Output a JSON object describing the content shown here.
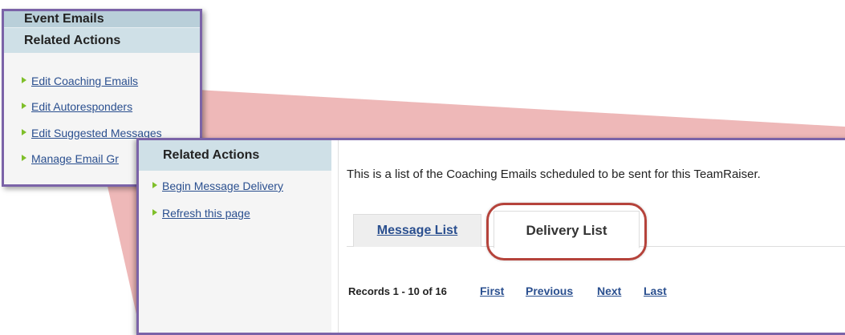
{
  "panel_top": {
    "title": "Event Emails",
    "heading": "Related Actions",
    "links": [
      "Edit Coaching Emails",
      "Edit Autoresponders",
      "Edit Suggested Messages",
      "Manage Email Gr"
    ]
  },
  "panel_main": {
    "sidebar": {
      "heading": "Related Actions",
      "links": [
        "Begin Message Delivery",
        "Refresh this page"
      ]
    },
    "description": "This is a list of the Coaching Emails scheduled to be sent for this TeamRaiser.",
    "tabs": {
      "message_list": "Message List",
      "delivery_list": "Delivery List"
    },
    "records": "Records 1 - 10 of 16",
    "pager": [
      "First",
      "Previous",
      "Next",
      "Last"
    ]
  },
  "colors": {
    "frame": "#7b63a8",
    "highlight_ring": "#b5433b",
    "connector": "#e8a0a0",
    "link": "#2a4f8f",
    "bullet": "#7fbf2a",
    "header_bg": "#cfe0e7"
  }
}
